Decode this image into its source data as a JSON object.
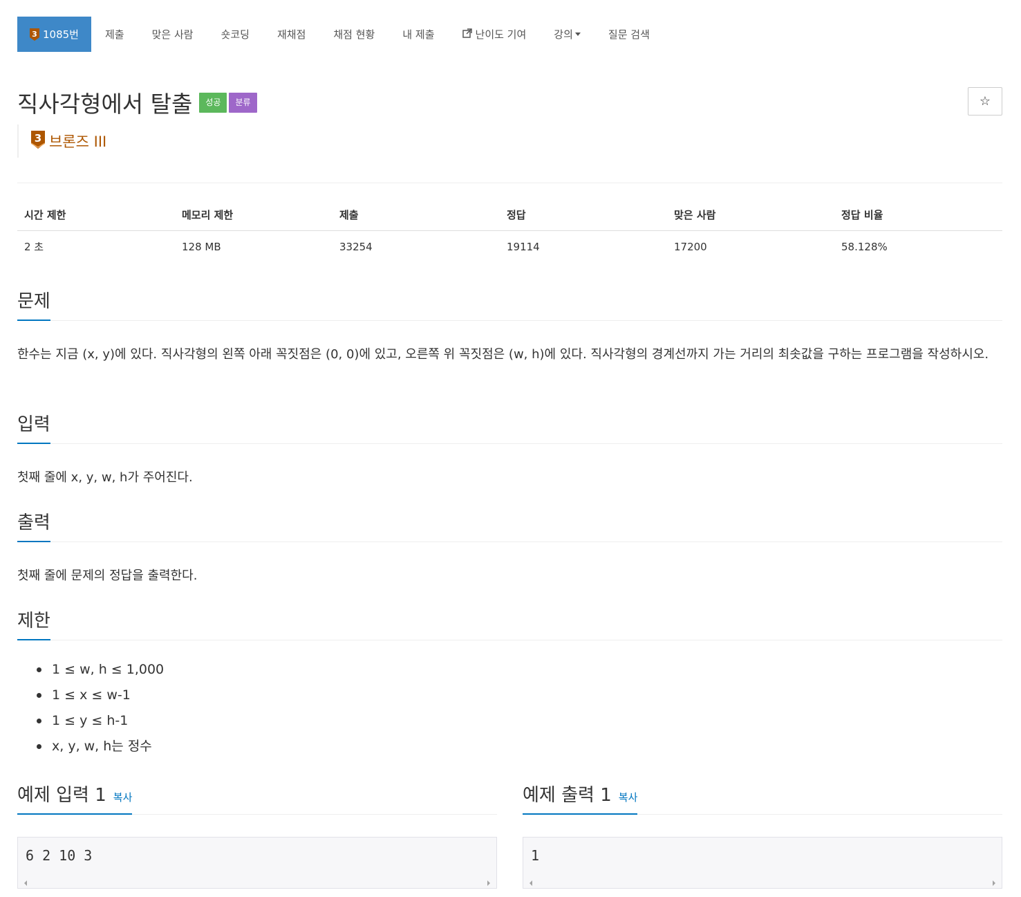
{
  "nav": {
    "problem_number": "1085번",
    "tier_digit": "3",
    "items": [
      {
        "label": "제출"
      },
      {
        "label": "맞은 사람"
      },
      {
        "label": "숏코딩"
      },
      {
        "label": "재채점"
      },
      {
        "label": "채점 현황"
      },
      {
        "label": "내 제출"
      },
      {
        "label": "난이도 기여"
      },
      {
        "label": "강의"
      },
      {
        "label": "질문 검색"
      }
    ]
  },
  "problem": {
    "title": "직사각형에서 탈출",
    "label_success": "성공",
    "label_category": "분류",
    "star": "☆",
    "tier_digit": "3",
    "tier_name": "브론즈 III"
  },
  "colors": {
    "accent": "#3e88c8",
    "bronze": "#ad5600",
    "success": "#5cb85c",
    "purple": "#9e67c9",
    "link": "#0076c0"
  },
  "info_table": {
    "headers": [
      "시간 제한",
      "메모리 제한",
      "제출",
      "정답",
      "맞은 사람",
      "정답 비율"
    ],
    "values": [
      "2 초",
      "128 MB",
      "33254",
      "19114",
      "17200",
      "58.128%"
    ]
  },
  "sections": {
    "description": {
      "title": "문제",
      "text": "한수는 지금 (x, y)에 있다. 직사각형의 왼쪽 아래 꼭짓점은 (0, 0)에 있고, 오른쪽 위 꼭짓점은 (w, h)에 있다. 직사각형의 경계선까지 가는 거리의 최솟값을 구하는 프로그램을 작성하시오."
    },
    "input": {
      "title": "입력",
      "text": "첫째 줄에 x, y, w, h가 주어진다."
    },
    "output": {
      "title": "출력",
      "text": "첫째 줄에 문제의 정답을 출력한다."
    },
    "limits": {
      "title": "제한",
      "items": [
        "1 ≤ w, h ≤ 1,000",
        "1 ≤ x ≤ w-1",
        "1 ≤ y ≤ h-1",
        "x, y, w, h는 정수"
      ]
    }
  },
  "samples": {
    "input": {
      "title": "예제 입력 1",
      "copy": "복사",
      "content": "6 2 10 3"
    },
    "output": {
      "title": "예제 출력 1",
      "copy": "복사",
      "content": "1"
    }
  }
}
